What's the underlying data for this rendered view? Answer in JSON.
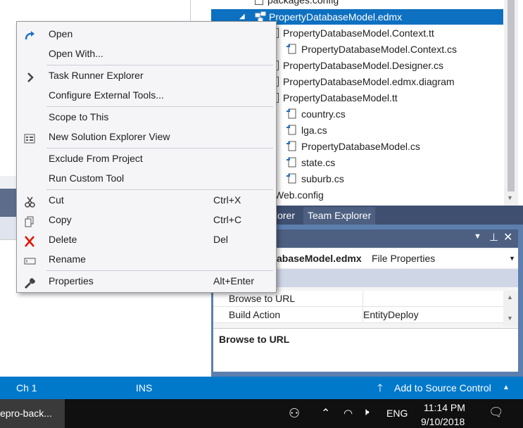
{
  "solution_explorer": {
    "items": [
      {
        "label": "packages.config",
        "type": "config"
      },
      {
        "label": "PropertyDatabaseModel.edmx",
        "type": "edmx",
        "selected": true
      },
      {
        "label": "PropertyDatabaseModel.Context.tt",
        "type": "file"
      },
      {
        "label": "PropertyDatabaseModel.Context.cs",
        "type": "cs"
      },
      {
        "label": "PropertyDatabaseModel.Designer.cs",
        "type": "file"
      },
      {
        "label": "PropertyDatabaseModel.edmx.diagram",
        "type": "file"
      },
      {
        "label": "PropertyDatabaseModel.tt",
        "type": "file"
      },
      {
        "label": "country.cs",
        "type": "cs"
      },
      {
        "label": "lga.cs",
        "type": "cs"
      },
      {
        "label": "PropertyDatabaseModel.cs",
        "type": "cs"
      },
      {
        "label": "state.cs",
        "type": "cs"
      },
      {
        "label": "suburb.cs",
        "type": "cs"
      },
      {
        "label": "Web.config",
        "type": "config"
      }
    ]
  },
  "tabs": {
    "solution_explorer": "lorer",
    "team_explorer": "Team Explorer"
  },
  "properties": {
    "title_suffix": "abaseModel.edmx",
    "kind": "File Properties",
    "rows": [
      {
        "name": "Browse to URL",
        "value": ""
      },
      {
        "name": "Build Action",
        "value": "EntityDeploy"
      }
    ],
    "description_title": "Browse to URL"
  },
  "context_menu": {
    "items": [
      {
        "label": "Open",
        "icon": "open-redo-icon",
        "shortcut": ""
      },
      {
        "label": "Open With...",
        "icon": "",
        "shortcut": ""
      },
      {
        "label": "Task Runner Explorer",
        "icon": "chevron-right-icon",
        "shortcut": ""
      },
      {
        "label": "Configure External Tools...",
        "icon": "",
        "shortcut": ""
      },
      {
        "label": "Scope to This",
        "icon": "",
        "shortcut": ""
      },
      {
        "label": "New Solution Explorer View",
        "icon": "solution-view-icon",
        "shortcut": ""
      },
      {
        "label": "Exclude From Project",
        "icon": "",
        "shortcut": ""
      },
      {
        "label": "Run Custom Tool",
        "icon": "",
        "shortcut": ""
      },
      {
        "label": "Cut",
        "icon": "scissors-icon",
        "shortcut": "Ctrl+X"
      },
      {
        "label": "Copy",
        "icon": "copy-icon",
        "shortcut": "Ctrl+C"
      },
      {
        "label": "Delete",
        "icon": "delete-x-icon",
        "shortcut": "Del"
      },
      {
        "label": "Rename",
        "icon": "rename-icon",
        "shortcut": ""
      },
      {
        "label": "Properties",
        "icon": "wrench-icon",
        "shortcut": "Alt+Enter"
      }
    ]
  },
  "status_bar": {
    "column": "Ch 1",
    "mode": "INS",
    "source_control": "Add to Source Control"
  },
  "taskbar": {
    "app_label": "epro-back...",
    "language": "ENG",
    "time": "11:14 PM",
    "date": "9/10/2018"
  },
  "colors": {
    "selection": "#0e70c0",
    "status_bar": "#0079cb",
    "tab_bar": "#3f4f70",
    "delete_red": "#e51400",
    "accent_blue": "#1e6fc4"
  }
}
